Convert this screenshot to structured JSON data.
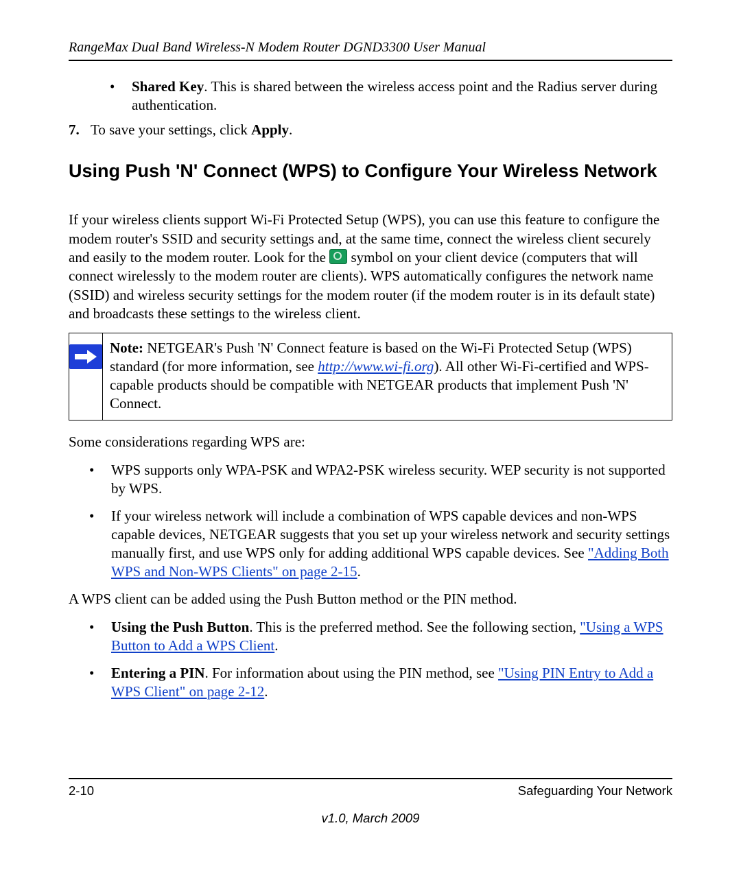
{
  "header": {
    "running_title": "RangeMax Dual Band Wireless-N Modem Router DGND3300 User Manual"
  },
  "shared_key": {
    "label": "Shared Key",
    "text": ". This is shared between the wireless access point and the Radius server during authentication."
  },
  "step7": {
    "num": "7.",
    "pre": "To save your settings, click ",
    "apply": "Apply",
    "post": "."
  },
  "section_heading": "Using Push 'N' Connect (WPS) to Configure Your Wireless Network",
  "intro": {
    "part1": "If your wireless clients support Wi-Fi Protected Setup (WPS), you can use this feature to configure the modem router's SSID and security settings and, at the same time, connect the wireless client securely and easily to the modem router. Look for the ",
    "part2": " symbol on your client device (computers that will connect wirelessly to the modem router are clients). WPS automatically configures the network name (SSID) and wireless security settings for the modem router (if the modem router is in its default state) and broadcasts these settings to the wireless client."
  },
  "note": {
    "label": "Note:",
    "pre": " NETGEAR's Push 'N' Connect feature is based on the Wi-Fi Protected Setup (WPS) standard (for more information, see ",
    "link": "http://www.wi-fi.org",
    "post": "). All other Wi-Fi-certified and WPS-capable products should be compatible with NETGEAR products that implement Push 'N' Connect."
  },
  "considerations_intro": "Some considerations regarding WPS are:",
  "consider1": "WPS supports only WPA-PSK and WPA2-PSK wireless security. WEP security is not supported by WPS.",
  "consider2": {
    "text": "If your wireless network will include a combination of WPS capable devices and non-WPS capable devices, NETGEAR suggests that you set up your wireless network and security settings manually first, and use WPS only for adding additional WPS capable devices. See ",
    "xref": "\"Adding Both WPS and Non-WPS Clients\" on page 2-15",
    "post": "."
  },
  "methods_intro": "A WPS client can be added using the Push Button method or the PIN method.",
  "method_push": {
    "label": "Using the Push Button",
    "text": ". This is the preferred method. See the following section, ",
    "xref": "\"Using a WPS Button to Add a WPS Client",
    "post": "."
  },
  "method_pin": {
    "label": "Entering a PIN",
    "text": ". For information about using the PIN method, see ",
    "xref": "\"Using PIN Entry to Add a WPS Client\" on page 2-12",
    "post": "."
  },
  "footer": {
    "page": "2-10",
    "section": "Safeguarding Your Network",
    "version": "v1.0, March 2009"
  }
}
